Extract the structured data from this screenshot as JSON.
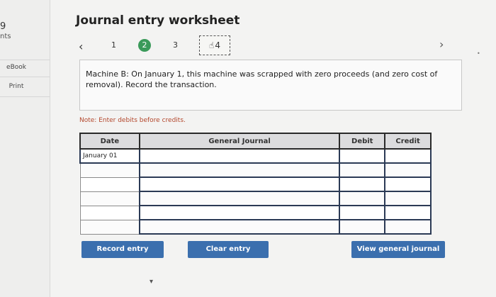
{
  "sidebar": {
    "points_number": "9",
    "points_label": "nts",
    "ebook_label": "eBook",
    "print_label": "Print"
  },
  "header": {
    "title": "Journal entry worksheet"
  },
  "steps": {
    "prev_icon": "‹",
    "next_icon": "›",
    "items": [
      "1",
      "2",
      "3",
      "4"
    ],
    "active_index": 1
  },
  "question": {
    "text": "Machine B: On January 1, this machine was scrapped with zero proceeds (and zero cost of removal). Record the transaction."
  },
  "note": "Note: Enter debits before credits.",
  "journal_table": {
    "columns": [
      "Date",
      "General Journal",
      "Debit",
      "Credit"
    ],
    "rows": [
      [
        "January 01",
        "",
        "",
        ""
      ],
      [
        "",
        "",
        "",
        ""
      ],
      [
        "",
        "",
        "",
        ""
      ],
      [
        "",
        "",
        "",
        ""
      ],
      [
        "",
        "",
        "",
        ""
      ],
      [
        "",
        "",
        "",
        ""
      ]
    ]
  },
  "buttons": {
    "record": "Record entry",
    "clear": "Clear entry",
    "view": "View general journal"
  },
  "colors": {
    "button_bg": "#3b6fae",
    "active_step": "#3a9a5a",
    "note_text": "#b3462b"
  }
}
